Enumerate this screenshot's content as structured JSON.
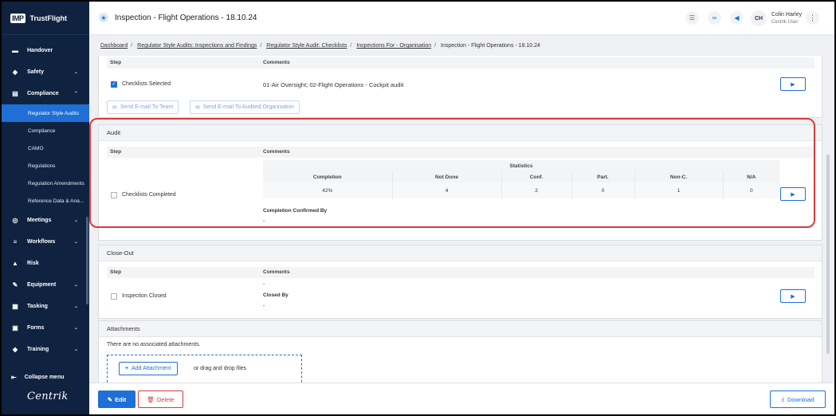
{
  "brand": {
    "logo": "IMP",
    "name": "TrustFlight",
    "footer_logo": "Centrik"
  },
  "sidebar": {
    "items": [
      {
        "label": "Handover",
        "icon": "handover-icon",
        "glyph": "▬",
        "chevron": ""
      },
      {
        "label": "Safety",
        "icon": "shield-icon",
        "glyph": "◈",
        "chevron": "⌄"
      },
      {
        "label": "Compliance",
        "icon": "document-icon",
        "glyph": "▤",
        "chevron": "⌃"
      }
    ],
    "sub_items": [
      "Regulator Style Audits",
      "Compliance",
      "CAMO",
      "Regulations",
      "Regulation Amendments",
      "Reference Data & Ana..."
    ],
    "items2": [
      {
        "label": "Meetings",
        "icon": "meetings-icon",
        "glyph": "◎",
        "chevron": "⌄"
      },
      {
        "label": "Workflows",
        "icon": "workflow-icon",
        "glyph": "≡",
        "chevron": "⌄"
      },
      {
        "label": "Risk",
        "icon": "risk-icon",
        "glyph": "▲",
        "chevron": ""
      },
      {
        "label": "Equipment",
        "icon": "wrench-icon",
        "glyph": "✎",
        "chevron": "⌄"
      },
      {
        "label": "Tasking",
        "icon": "tasking-icon",
        "glyph": "▦",
        "chevron": "⌄"
      },
      {
        "label": "Forms",
        "icon": "forms-icon",
        "glyph": "▣",
        "chevron": "⌄"
      },
      {
        "label": "Training",
        "icon": "graduation-icon",
        "glyph": "◆",
        "chevron": "⌄"
      }
    ],
    "collapse_label": "Collapse menu"
  },
  "header": {
    "title": "Inspection",
    "subtitle": " - Flight Operations - 18.10.24",
    "user_initials": "CH",
    "user_name": "Colin Harley",
    "user_role": "Centrik User"
  },
  "breadcrumb": {
    "items": [
      "Dashboard",
      "Regulator Style Audits: Inspections and Findings",
      "Regulator Style Audit: Checklists",
      "Inspections For - Organisation"
    ],
    "current": "Inspection - Flight Operations - 18.10.24"
  },
  "top_section": {
    "col_step": "Step",
    "col_comments": "Comments",
    "step_label": "Checklists Selected",
    "comment": "01-Air Oversight; 02-Flight Operations - Cockpit audit",
    "email_team": "Send E-mail To Team",
    "email_org": "Send E-mail To Audited Organisation"
  },
  "audit": {
    "title": "Audit",
    "col_step": "Step",
    "col_comments": "Comments",
    "step_label": "Checklists Completed",
    "statistics_label": "Statistics",
    "headers": [
      "Completion",
      "Not Done",
      "Conf.",
      "Part.",
      "Non-C.",
      "N/A"
    ],
    "values": [
      "42%",
      "4",
      "2",
      "0",
      "1",
      "0"
    ],
    "confirmed_label": "Completion Confirmed By",
    "confirmed_value": "-"
  },
  "closeout": {
    "title": "Close-Out",
    "col_step": "Step",
    "col_comments": "Comments",
    "step_label": "Inspection Closed",
    "comment": "-",
    "closed_by_label": "Closed By",
    "closed_by_value": "-"
  },
  "attachments": {
    "title": "Attachments",
    "empty_text": "There are no associated attachments.",
    "add_label": "Add Attachment",
    "drag_text": "or drag and drop files"
  },
  "actions": {
    "edit": "Edit",
    "delete": "Delete",
    "download": "Download"
  },
  "colors": {
    "sidebar": "#0f2340",
    "accent": "#1f6fd6",
    "danger": "#d83a3a"
  }
}
